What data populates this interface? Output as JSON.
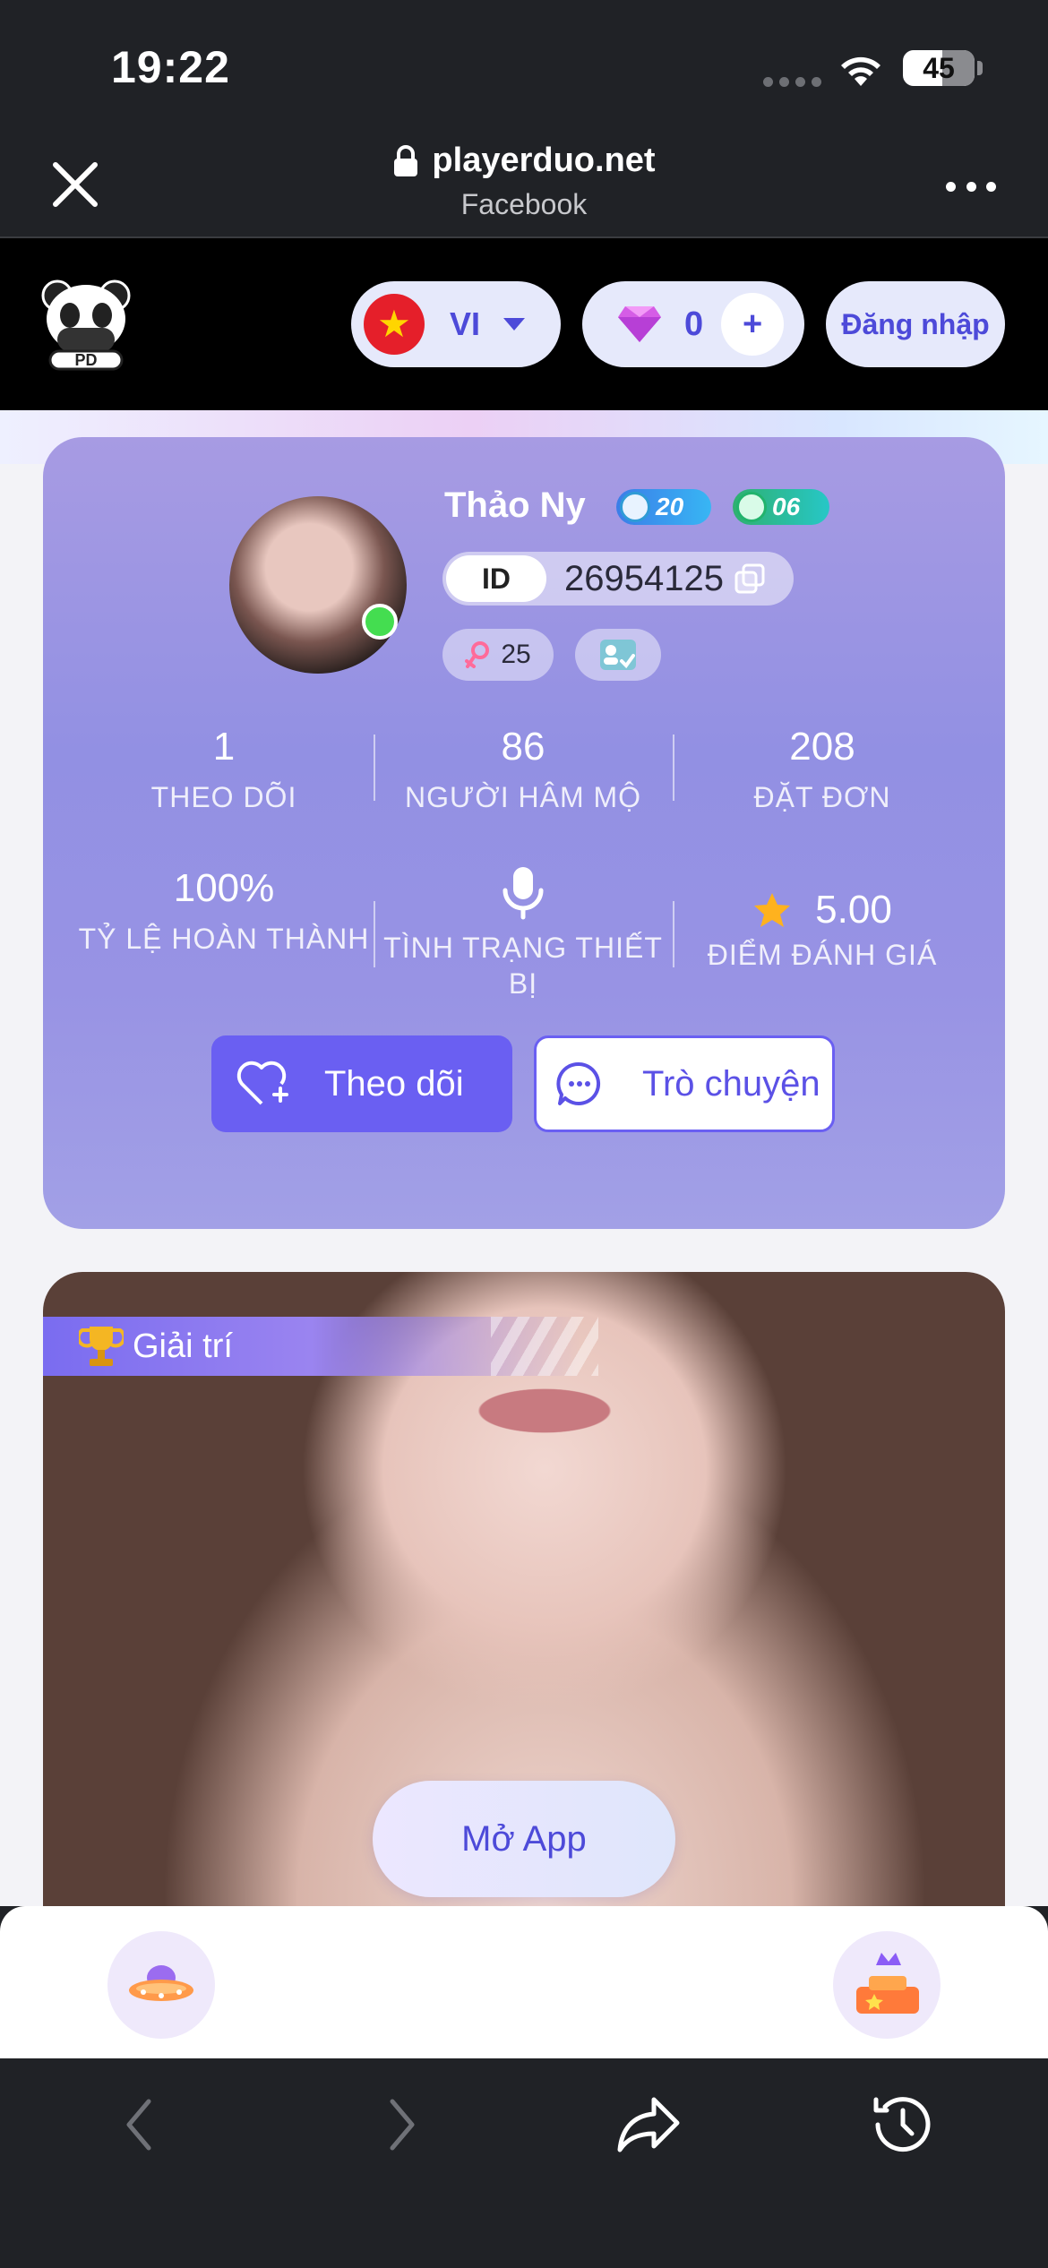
{
  "status_bar": {
    "time": "19:22",
    "battery": "45"
  },
  "browser": {
    "domain": "playerduo.net",
    "source": "Facebook"
  },
  "header": {
    "language": "VI",
    "gem_count": "0",
    "plus": "+",
    "login_label": "Đăng nhập"
  },
  "profile": {
    "name": "Thảo Ny",
    "level_badge": "20",
    "gem_badge": "06",
    "id_label": "ID",
    "id_value": "26954125",
    "age": "25",
    "stats": [
      {
        "value": "1",
        "label": "THEO DÕI"
      },
      {
        "value": "86",
        "label": "NGƯỜI HÂM MỘ"
      },
      {
        "value": "208",
        "label": "ĐẶT ĐƠN"
      },
      {
        "value": "100%",
        "label": "TỶ LỆ HOÀN THÀNH"
      },
      {
        "label": "TÌNH TRẠNG THIẾT BỊ"
      },
      {
        "value": "5.00",
        "label": "ĐIỂM ĐÁNH GIÁ"
      }
    ],
    "follow_label": "Theo dõi",
    "chat_label": "Trò chuyện"
  },
  "media": {
    "category": "Giải trí",
    "open_app_label": "Mở App"
  },
  "colors": {
    "accent": "#6a5ff2",
    "header_bg": "#000000",
    "card_gradient": "#9290e3"
  }
}
